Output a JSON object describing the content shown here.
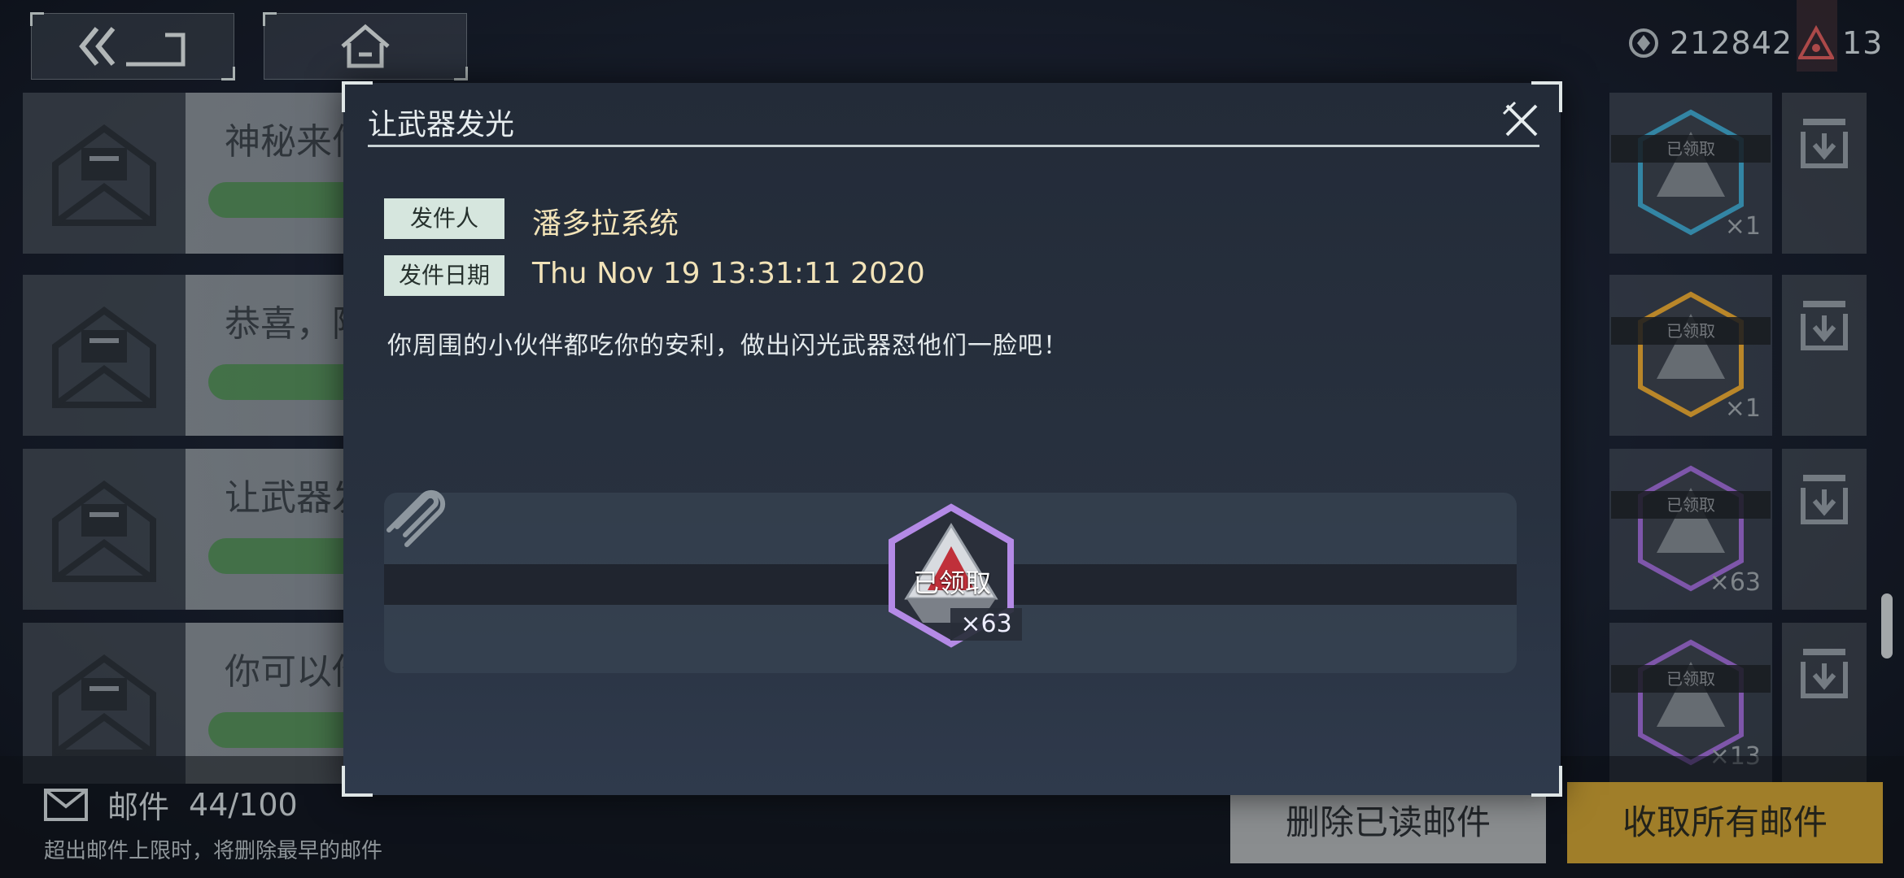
{
  "top": {
    "back_icon": "back-arrows-icon",
    "home_icon": "home-icon",
    "currency1": {
      "icon": "crystal-icon",
      "value": "212842"
    },
    "currency2": {
      "icon": "warning-triangle-icon",
      "value": "13"
    }
  },
  "mail_list": [
    {
      "title": "神秘来信",
      "reward_claimed": "已领取",
      "reward_count": "×1",
      "reward_color": "#3fa3c9"
    },
    {
      "title": "恭喜，阿",
      "reward_claimed": "已领取",
      "reward_count": "×1",
      "reward_color": "#e2a432"
    },
    {
      "title": "让武器发",
      "reward_claimed": "已领取",
      "reward_count": "×63",
      "reward_color": "#9a6ad0"
    },
    {
      "title": "你可以你",
      "reward_claimed": "已领取",
      "reward_count": "×13",
      "reward_color": "#9a6ad0"
    }
  ],
  "bottom": {
    "mail_label": "邮件",
    "mail_count": "44/100",
    "hint": "超出邮件上限时，将删除最早的邮件",
    "delete_read_label": "删除已读邮件",
    "collect_all_label": "收取所有邮件"
  },
  "modal": {
    "title": "让武器发光",
    "sender_label": "发件人",
    "sender": "潘多拉系统",
    "date_label": "发件日期",
    "date": "Thu Nov 19 13:31:11 2020",
    "message": "你周围的小伙伴都吃你的安利，做出闪光武器怼他们一脸吧！",
    "attachment": {
      "claimed_label": "已领取",
      "count": "×63"
    }
  }
}
